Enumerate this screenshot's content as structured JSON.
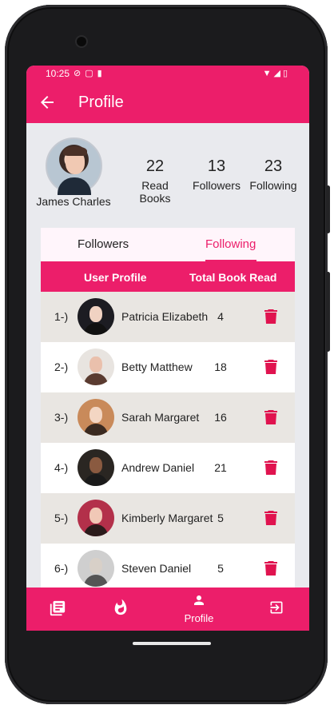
{
  "status_bar": {
    "time": "10:25",
    "left_icons": [
      "vpn-icon",
      "sim-icon",
      "sd-card-icon"
    ],
    "right_icons": [
      "wifi-icon",
      "signal-icon",
      "battery-icon"
    ]
  },
  "app_bar": {
    "title": "Profile"
  },
  "profile": {
    "name": "James Charles",
    "stats": [
      {
        "value": "22",
        "label": "Read Books"
      },
      {
        "value": "13",
        "label": "Followers"
      },
      {
        "value": "23",
        "label": "Following"
      }
    ]
  },
  "tabs": {
    "followers": "Followers",
    "following": "Following",
    "active": "following"
  },
  "table": {
    "headers": {
      "profile": "User Profile",
      "books": "Total Book Read"
    },
    "rows": [
      {
        "index": "1-)",
        "name": "Patricia Elizabeth",
        "count": "4"
      },
      {
        "index": "2-)",
        "name": "Betty Matthew",
        "count": "18"
      },
      {
        "index": "3-)",
        "name": "Sarah Margaret",
        "count": "16"
      },
      {
        "index": "4-)",
        "name": "Andrew Daniel",
        "count": "21"
      },
      {
        "index": "5-)",
        "name": "Kimberly Margaret",
        "count": "5"
      },
      {
        "index": "6-)",
        "name": "Steven Daniel",
        "count": "5"
      }
    ]
  },
  "bottom_nav": {
    "items": [
      {
        "icon": "library-books-icon",
        "label": ""
      },
      {
        "icon": "whatshot-icon",
        "label": ""
      },
      {
        "icon": "person-icon",
        "label": "Profile"
      },
      {
        "icon": "logout-icon",
        "label": ""
      }
    ]
  },
  "colors": {
    "primary": "#ec1e6a",
    "background": "#e9eaee",
    "row_alt": "#e9e6e2",
    "delete": "#e0134f"
  }
}
